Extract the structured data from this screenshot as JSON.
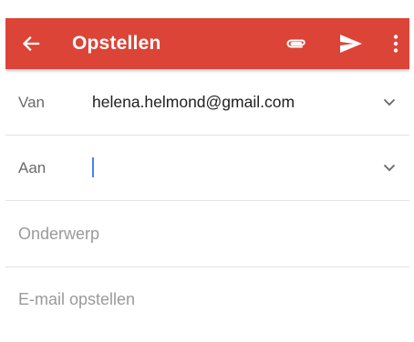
{
  "colors": {
    "toolbar": "#db4437",
    "caret": "#4285f4"
  },
  "toolbar": {
    "title": "Opstellen",
    "icons": {
      "back": "arrow-back-icon",
      "attach": "paperclip-icon",
      "send": "send-icon",
      "more": "more-vert-icon"
    }
  },
  "from": {
    "label": "Van",
    "value": "helena.helmond@gmail.com"
  },
  "to": {
    "label": "Aan",
    "value": ""
  },
  "subject": {
    "placeholder": "Onderwerp"
  },
  "body": {
    "placeholder": "E-mail opstellen"
  }
}
